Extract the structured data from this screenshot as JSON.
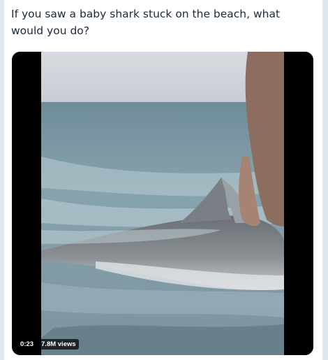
{
  "tweet": {
    "text": "If you saw a baby shark stuck on the beach, what would you do?"
  },
  "media": {
    "duration": "0:23",
    "views": "7.8M views",
    "icon": "video-thumbnail"
  },
  "colors": {
    "text": "#1c2938",
    "border": "#e1e8ed",
    "badge_bg": "#000000"
  }
}
